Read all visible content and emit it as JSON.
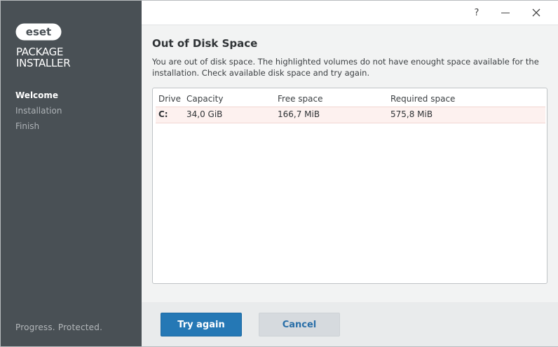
{
  "brand": {
    "logo_text": "eset",
    "product_line1": "PACKAGE",
    "product_line2": "INSTALLER",
    "tagline": "Progress. Protected."
  },
  "nav": {
    "items": [
      {
        "label": "Welcome",
        "active": true
      },
      {
        "label": "Installation",
        "active": false
      },
      {
        "label": "Finish",
        "active": false
      }
    ]
  },
  "titlebar": {
    "help_label": "?"
  },
  "main": {
    "title": "Out of Disk Space",
    "description": "You are out of disk space. The highlighted volumes do not have enought space available for the installation. Check available disk space and try again."
  },
  "table": {
    "columns": [
      "Drive",
      "Capacity",
      "Free space",
      "Required space"
    ],
    "rows": [
      {
        "drive": "C:",
        "capacity": "34,0 GiB",
        "free": "166,7 MiB",
        "required": "575,8 MiB",
        "highlighted": true
      }
    ]
  },
  "footer": {
    "try_again_label": "Try again",
    "cancel_label": "Cancel"
  },
  "colors": {
    "sidebar": "#495055",
    "primary": "#2578b5",
    "highlight_row": "#fdf1ef"
  }
}
